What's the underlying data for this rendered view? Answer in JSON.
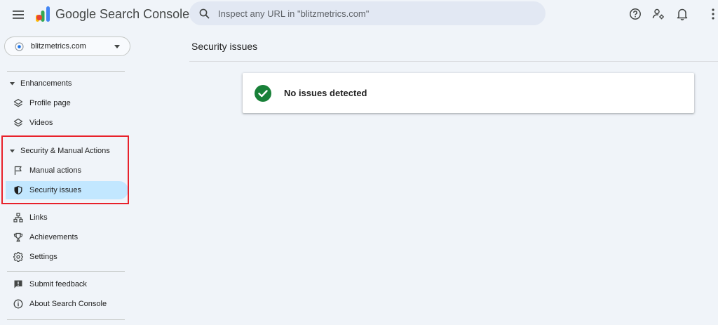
{
  "app": {
    "name": "Google Search Console"
  },
  "search": {
    "placeholder": "Inspect any URL in \"blitzmetrics.com\""
  },
  "property": {
    "label": "blitzmetrics.com"
  },
  "sidebar": {
    "enhancements": {
      "label": "Enhancements",
      "items": [
        {
          "label": "Profile page",
          "icon": "layers-icon"
        },
        {
          "label": "Videos",
          "icon": "layers-icon"
        }
      ]
    },
    "security": {
      "label": "Security & Manual Actions",
      "items": [
        {
          "label": "Manual actions",
          "icon": "flag-icon"
        },
        {
          "label": "Security issues",
          "icon": "shield-icon",
          "active": true
        }
      ]
    },
    "general": [
      {
        "label": "Links",
        "icon": "links-icon"
      },
      {
        "label": "Achievements",
        "icon": "trophy-icon"
      },
      {
        "label": "Settings",
        "icon": "gear-icon"
      }
    ],
    "footer": [
      {
        "label": "Submit feedback",
        "icon": "feedback-icon"
      },
      {
        "label": "About Search Console",
        "icon": "info-icon"
      }
    ]
  },
  "main": {
    "title": "Security issues",
    "status": {
      "text": "No issues detected",
      "color": "#188038"
    }
  },
  "colors": {
    "active_nav": "#c2e7ff",
    "highlight": "#e8212b",
    "background": "#f0f4f9"
  }
}
